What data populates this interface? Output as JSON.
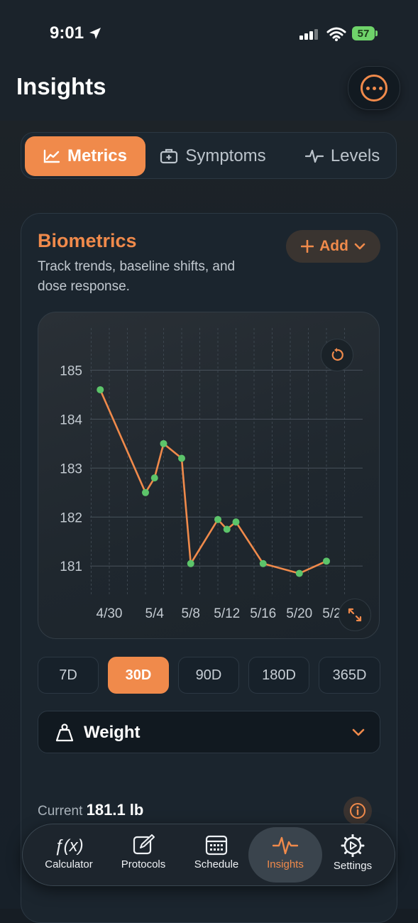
{
  "status_bar": {
    "time": "9:01",
    "battery": "57"
  },
  "header": {
    "title": "Insights"
  },
  "segments": [
    {
      "label": "Metrics",
      "icon": "chart-line-icon",
      "active": true
    },
    {
      "label": "Symptoms",
      "icon": "medical-kit-icon",
      "active": false
    },
    {
      "label": "Levels",
      "icon": "pulse-icon",
      "active": false
    }
  ],
  "card": {
    "title": "Biometrics",
    "subtitle": "Track trends, baseline shifts, and dose response.",
    "add_label": "Add"
  },
  "chart_data": {
    "type": "line",
    "title": "",
    "xlabel": "",
    "ylabel": "",
    "x_ticks": [
      "4/30",
      "5/4",
      "5/8",
      "5/12",
      "5/16",
      "5/20",
      "5/24"
    ],
    "y_ticks": [
      185,
      184,
      183,
      182,
      181
    ],
    "ylim": [
      179.8,
      185.6
    ],
    "series": [
      {
        "color": "#f08a4b",
        "point_color": "#5cc46a",
        "points": [
          [
            "4/29",
            184.6
          ],
          [
            "5/3",
            182.5
          ],
          [
            "5/4",
            182.8
          ],
          [
            "5/5",
            183.5
          ],
          [
            "5/7",
            183.2
          ],
          [
            "5/8",
            181.05
          ],
          [
            "5/11",
            181.95
          ],
          [
            "5/12",
            181.75
          ],
          [
            "5/13",
            181.9
          ],
          [
            "5/16",
            181.05
          ],
          [
            "5/20",
            180.85
          ],
          [
            "5/23",
            181.1
          ]
        ]
      }
    ],
    "grid": true
  },
  "ranges": [
    {
      "label": "7D",
      "active": false
    },
    {
      "label": "30D",
      "active": true
    },
    {
      "label": "90D",
      "active": false
    },
    {
      "label": "180D",
      "active": false
    },
    {
      "label": "365D",
      "active": false
    }
  ],
  "metric_select": {
    "value": "Weight"
  },
  "current": {
    "label": "Current",
    "value": "181.1 lb"
  },
  "tabs": [
    {
      "label": "Calculator",
      "icon": "function-icon",
      "active": false
    },
    {
      "label": "Protocols",
      "icon": "edit-icon",
      "active": false
    },
    {
      "label": "Schedule",
      "icon": "calendar-icon",
      "active": false
    },
    {
      "label": "Insights",
      "icon": "pulse-icon",
      "active": true
    },
    {
      "label": "Settings",
      "icon": "gear-icon",
      "active": false
    }
  ]
}
